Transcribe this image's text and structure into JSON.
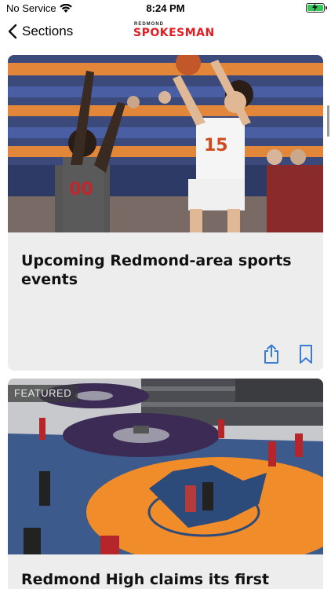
{
  "status_bar": {
    "carrier": "No Service",
    "time": "8:24 PM",
    "battery_level": 1.0,
    "battery_color": "#35c759"
  },
  "nav": {
    "back_label": "Sections",
    "back_icon": "chevron-left-icon",
    "logo_small": "REDMOND",
    "logo_main": "SPOKESMAN",
    "logo_color": "#e31b23"
  },
  "feed": {
    "articles": [
      {
        "title": "Upcoming Redmond-area sports events",
        "image": "basketball-photo",
        "featured": false,
        "actions": [
          {
            "icon": "share-icon"
          },
          {
            "icon": "bookmark-icon"
          }
        ]
      },
      {
        "badge": "FEATURED",
        "title": "Redmond High claims its first ever",
        "image": "wrestling-photo",
        "featured": true
      }
    ],
    "accent_color": "#3a7bd5"
  }
}
